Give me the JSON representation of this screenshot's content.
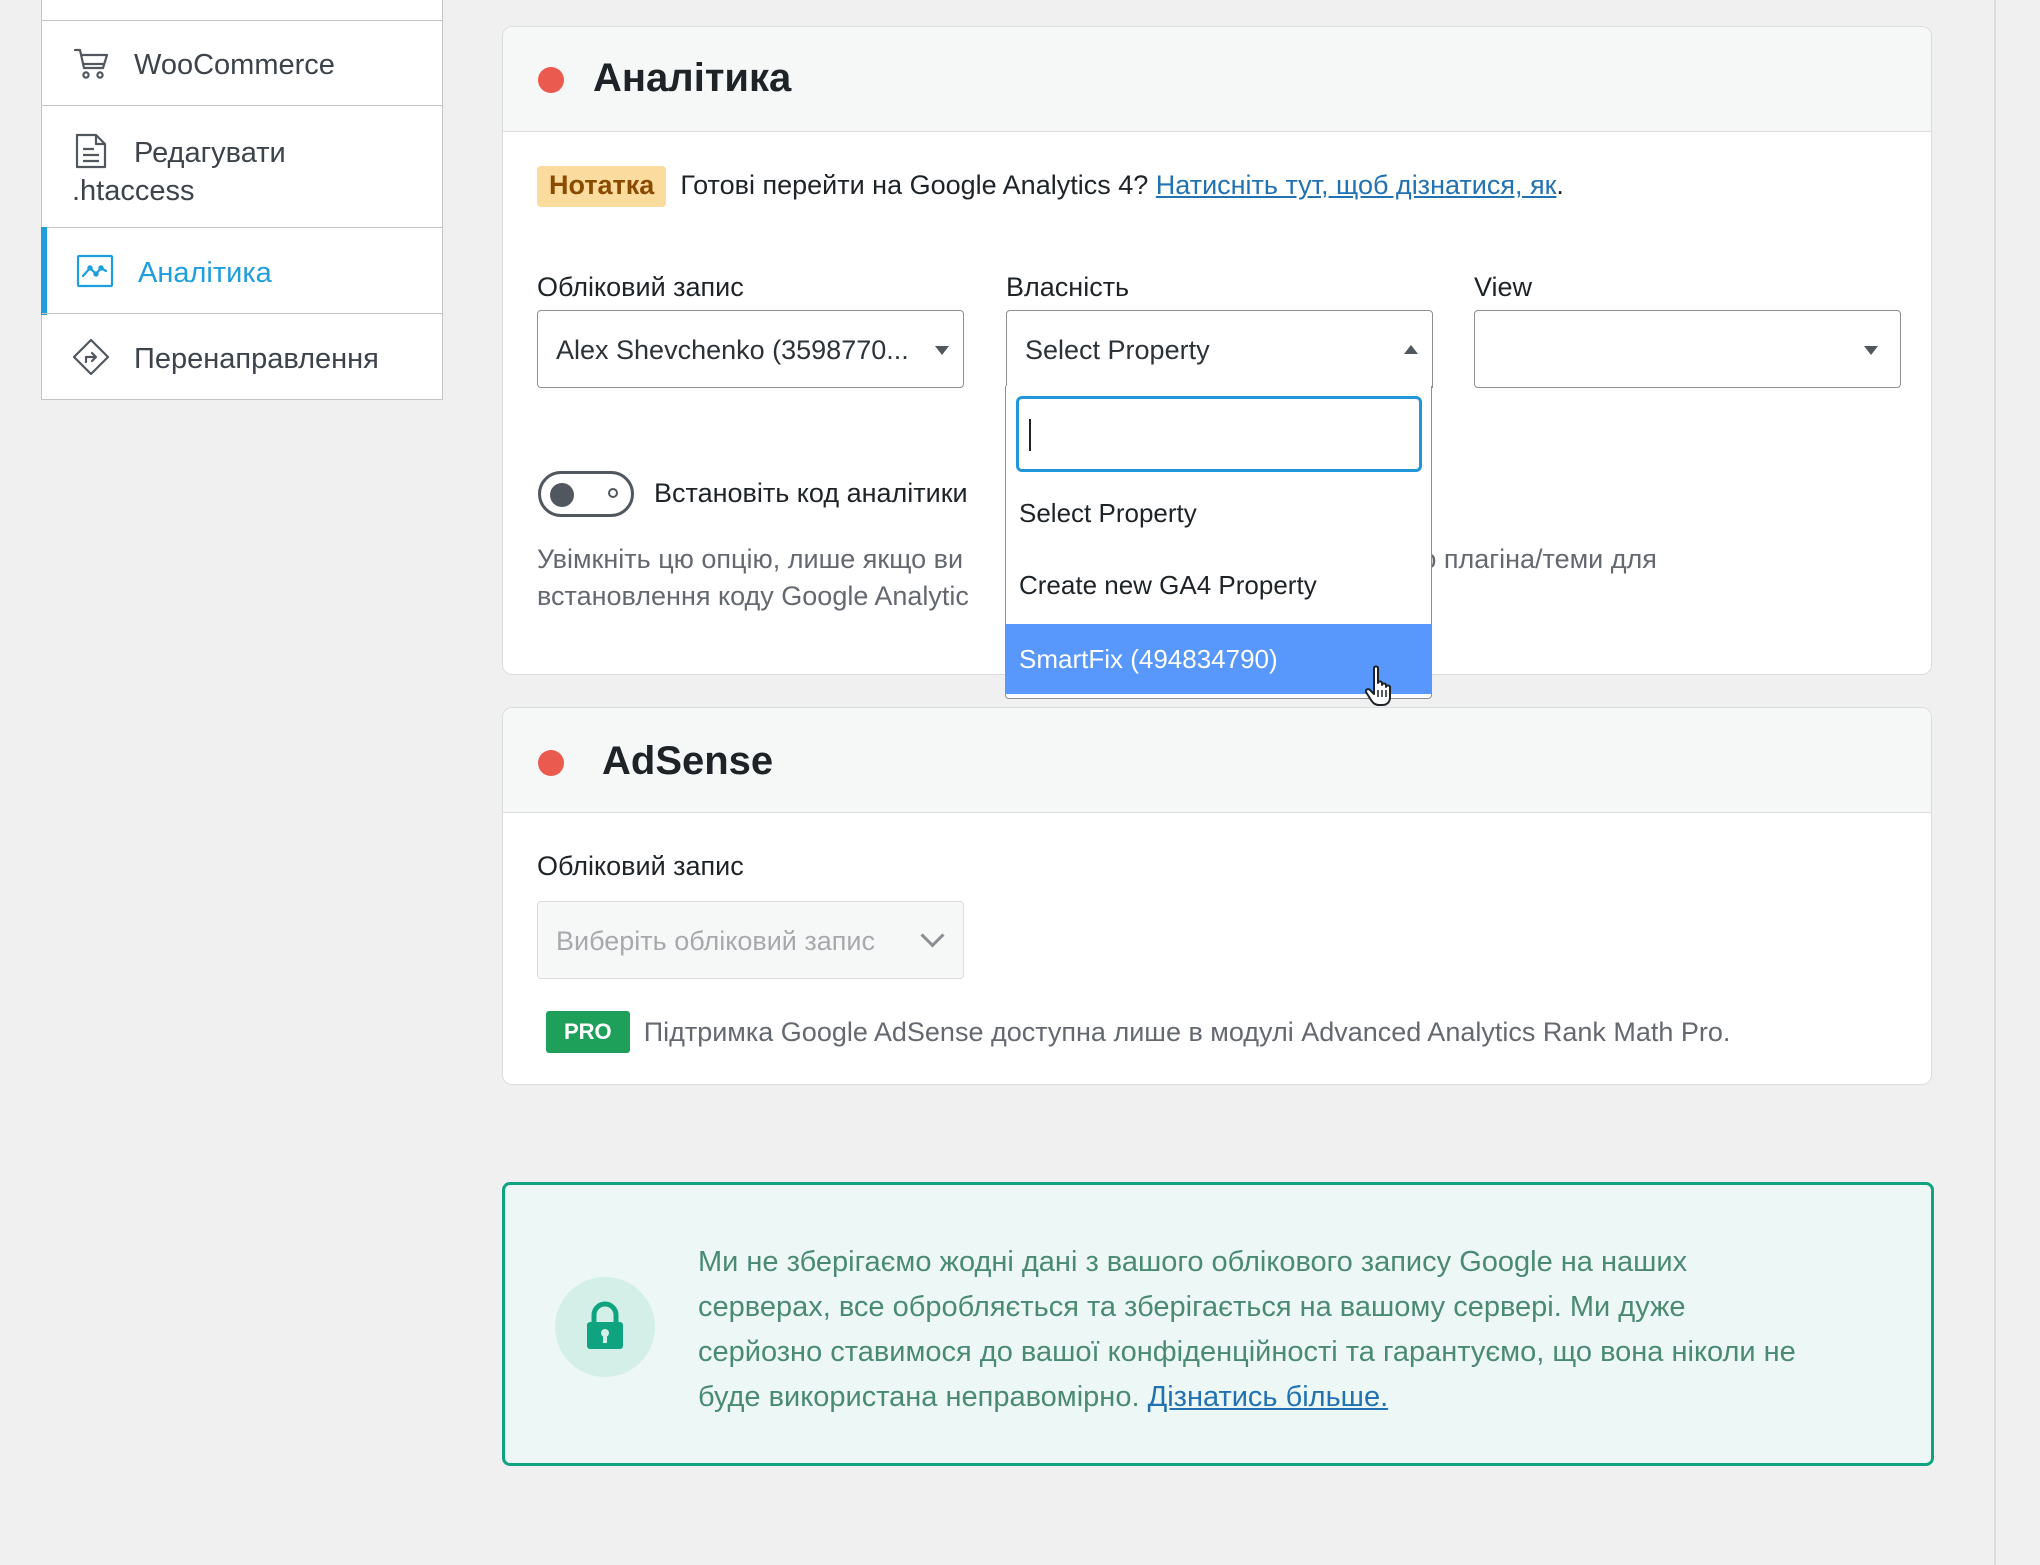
{
  "sidebar": {
    "items": [
      {
        "label": "WooCommerce",
        "icon": "cart-icon"
      },
      {
        "label_line1": "Редагувати",
        "label_line2": ".htaccess",
        "icon": "document-icon"
      },
      {
        "label": "Аналітика",
        "icon": "chart-icon",
        "active": true
      },
      {
        "label": "Перенаправлення",
        "icon": "redirect-icon"
      }
    ]
  },
  "analytics": {
    "title": "Аналітика",
    "note_badge": "Нотатка",
    "note_text": "Готові перейти на Google Analytics 4?",
    "note_link": "Натисніть тут, щоб дізнатися, як",
    "note_end": ".",
    "account_label": "Обліковий запис",
    "account_value": "Alex Shevchenko (3598770...",
    "property_label": "Власність",
    "property_value": "Select Property",
    "view_label": "View",
    "view_value": "",
    "install_toggle_label": "Встановіть код аналітики",
    "desc_line1_left": "Увімкніть цю опцію, лише якщо ви",
    "desc_line1_right": "ого плагіна/теми для",
    "desc_line2": "встановлення коду Google Analytic",
    "dropdown": {
      "search_value": "",
      "options": [
        "Select Property",
        "Create new GA4 Property",
        "SmartFix (494834790)"
      ],
      "highlighted": "SmartFix (494834790)"
    }
  },
  "adsense": {
    "title": "AdSense",
    "account_label": "Обліковий запис",
    "account_placeholder": "Виберіть обліковий запис",
    "pro_badge": "PRO",
    "pro_text": "Підтримка Google AdSense доступна лише в модулі Advanced Analytics Rank Math Pro."
  },
  "privacy": {
    "line1": "Ми не зберігаємо жодні дані з вашого облікового запису Google на наших",
    "line2": "серверах, все обробляється та зберігається на вашому сервері. Ми дуже",
    "line3": "серйозно ставимося до вашої конфіденційності та гарантуємо, що вона ніколи не",
    "line4": "буде використана неправомірно.",
    "link": "Дізнатись більше."
  },
  "colors": {
    "accent": "#1e9edc",
    "status_dot": "#eb5a4e",
    "highlight": "#5897fb",
    "privacy_border": "#10a37f",
    "pro_badge": "#1fa05a"
  }
}
